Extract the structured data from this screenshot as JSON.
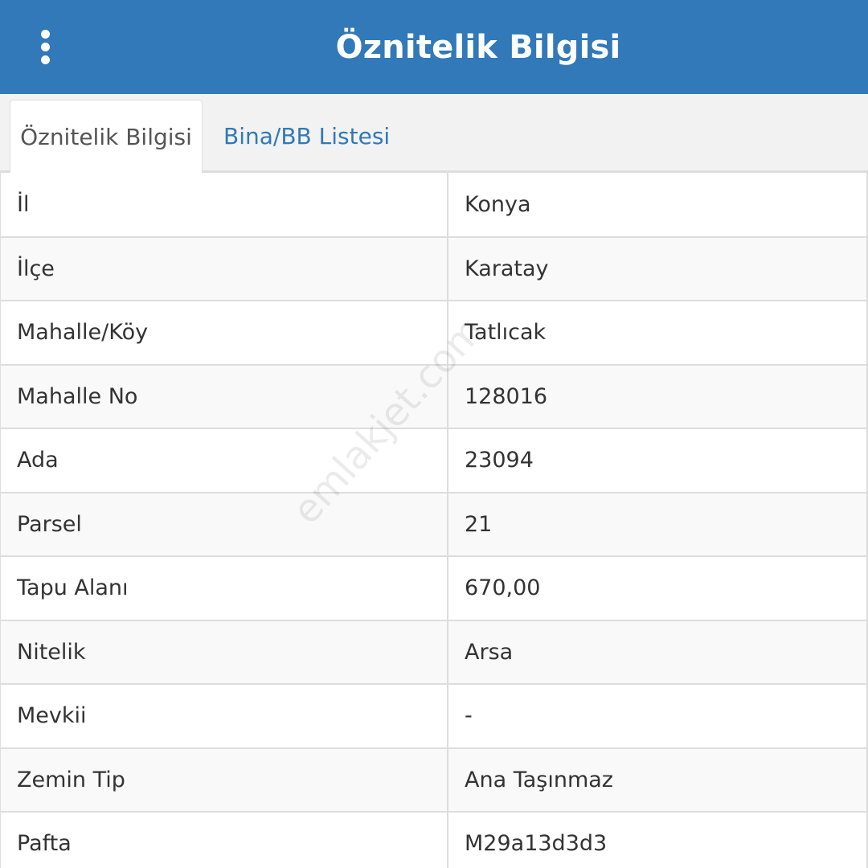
{
  "header": {
    "menu_icon": "more-vertical-icon",
    "title": "Öznitelik Bilgisi",
    "background_color": "#3179b8"
  },
  "tabs": [
    {
      "label": "Öznitelik Bilgisi",
      "active": true
    },
    {
      "label": "Bina/BB Listesi",
      "active": false
    }
  ],
  "attributes": [
    {
      "label": "İl",
      "value": "Konya"
    },
    {
      "label": "İlçe",
      "value": "Karatay"
    },
    {
      "label": "Mahalle/Köy",
      "value": "Tatlıcak"
    },
    {
      "label": "Mahalle No",
      "value": "128016"
    },
    {
      "label": "Ada",
      "value": "23094"
    },
    {
      "label": "Parsel",
      "value": "21"
    },
    {
      "label": "Tapu Alanı",
      "value": "670,00"
    },
    {
      "label": "Nitelik",
      "value": "Arsa"
    },
    {
      "label": "Mevkii",
      "value": "-"
    },
    {
      "label": "Zemin Tip",
      "value": "Ana Taşınmaz"
    },
    {
      "label": "Pafta",
      "value": "M29a13d3d3"
    }
  ],
  "watermark": "emlakjet.com"
}
